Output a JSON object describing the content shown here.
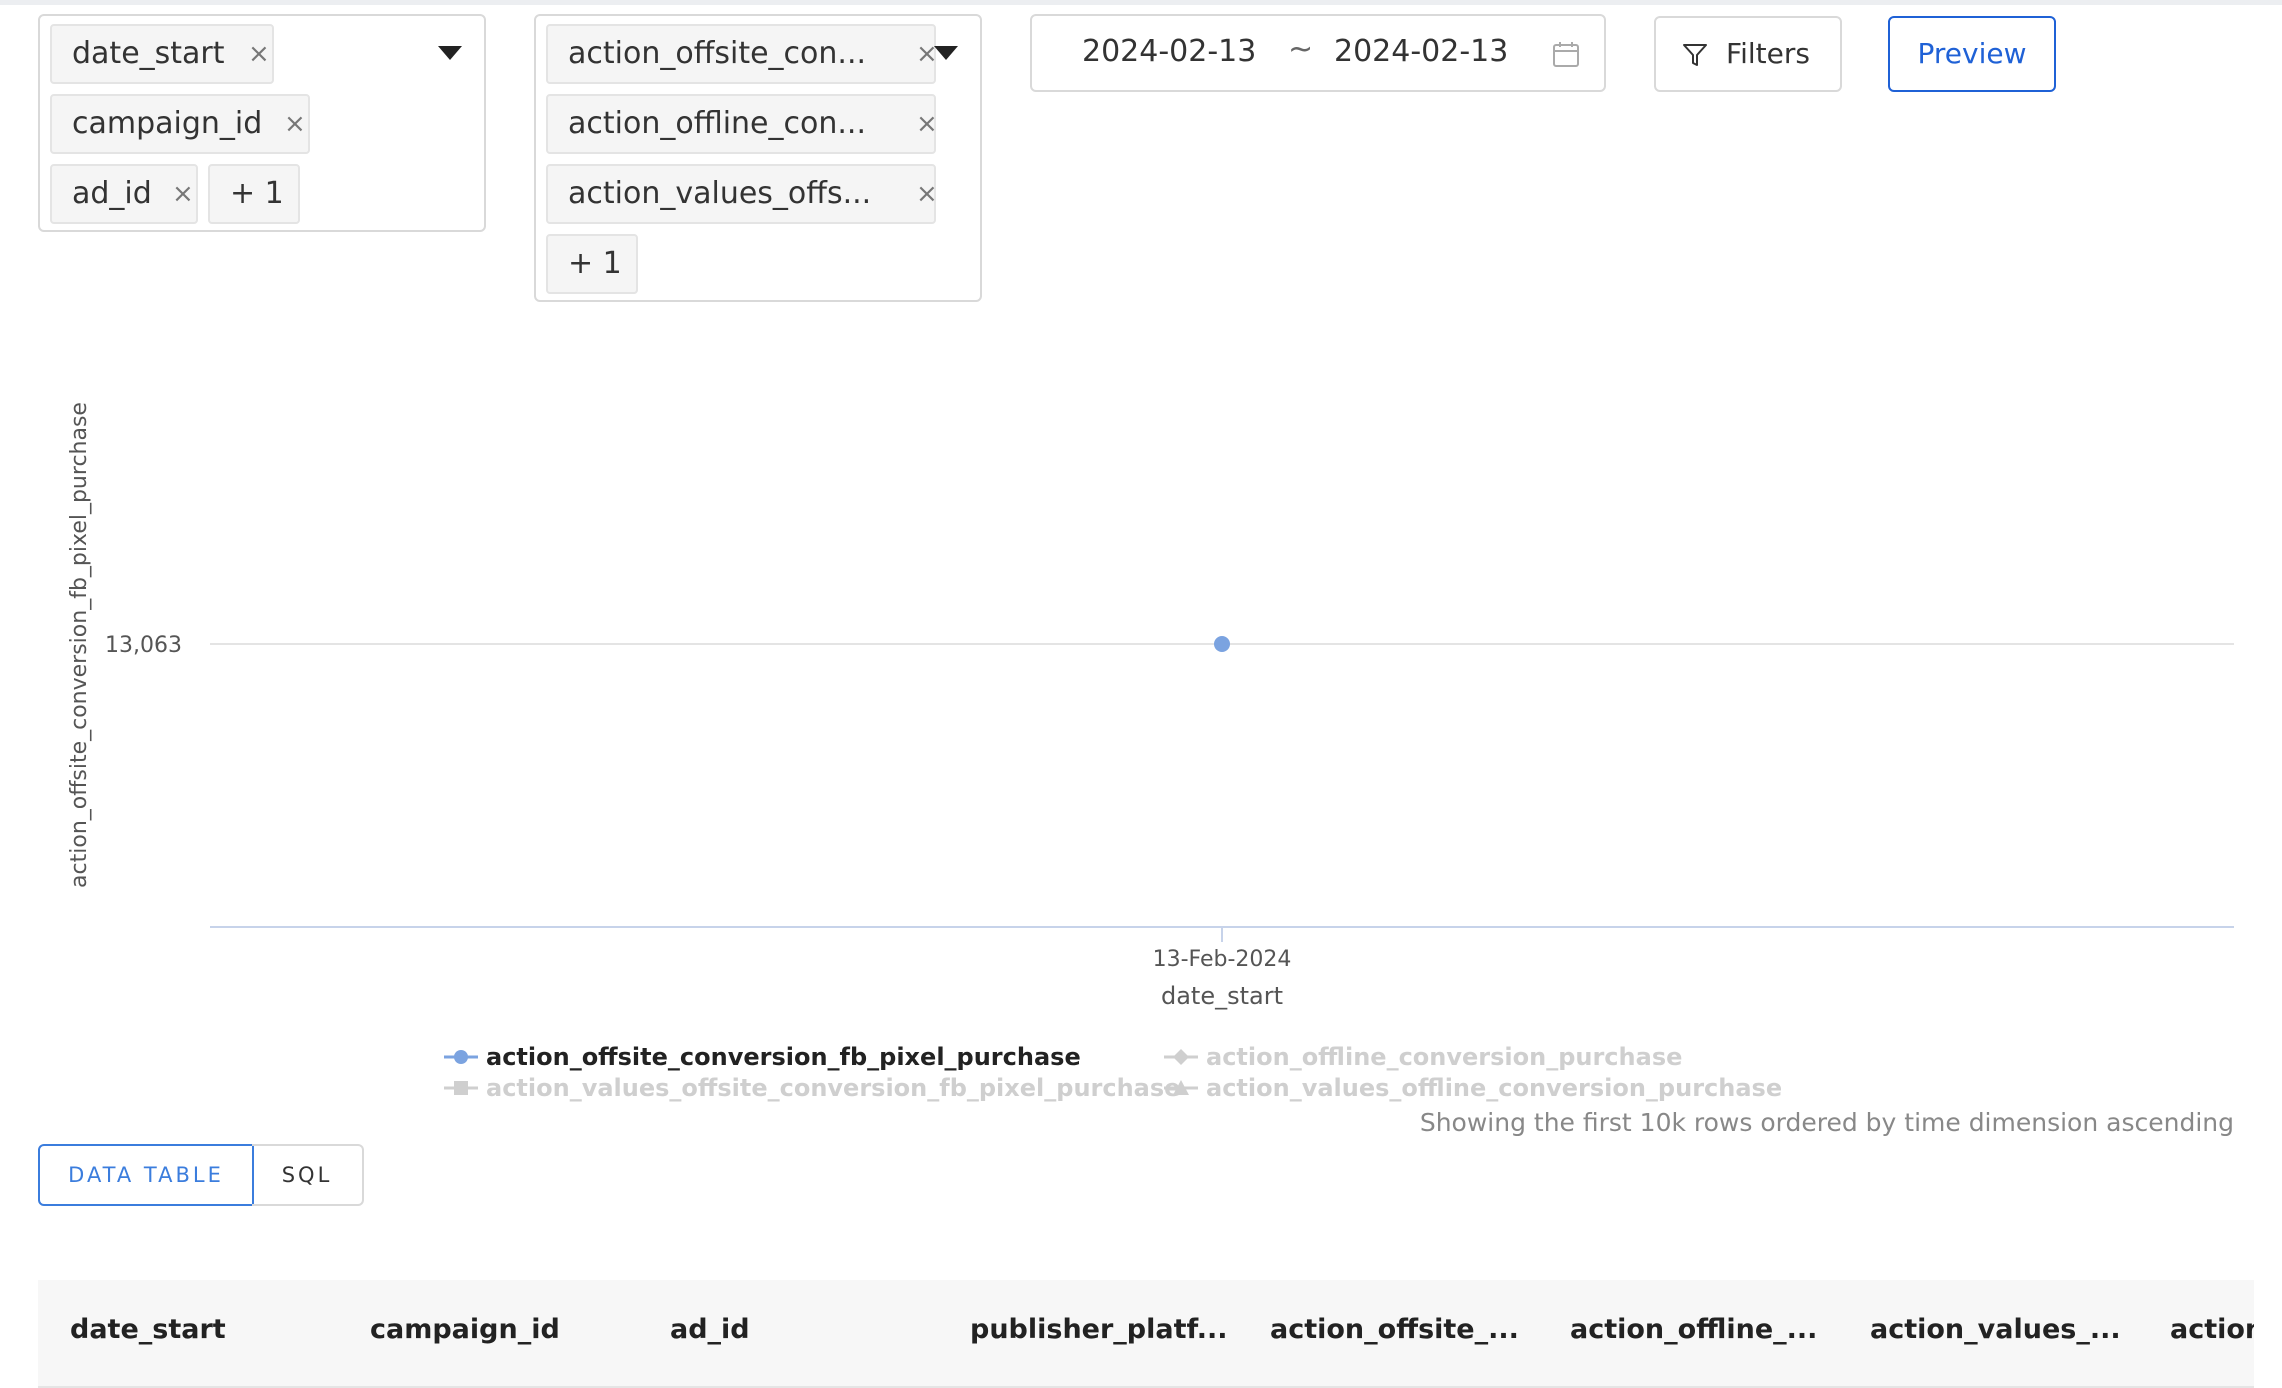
{
  "dimensions": {
    "tags": [
      "date_start",
      "campaign_id",
      "ad_id"
    ],
    "more": "+ 1"
  },
  "measures": {
    "tags": [
      "action_offsite_con...",
      "action_offline_con...",
      "action_values_offs..."
    ],
    "more": "+ 1"
  },
  "date_range": {
    "start": "2024-02-13",
    "separator": "~",
    "end": "2024-02-13"
  },
  "toolbar": {
    "filters_label": "Filters",
    "preview_label": "Preview"
  },
  "chart_data": {
    "type": "line",
    "x": [
      "13-Feb-2024"
    ],
    "series": [
      {
        "name": "action_offsite_conversion_fb_pixel_purchase",
        "values": [
          13063
        ]
      }
    ],
    "xlabel": "date_start",
    "ylabel": "action_offsite_conversion_fb_pixel_purchase",
    "y_tick_labels": [
      "13,063"
    ],
    "grid": true,
    "legend_position": "bottom"
  },
  "legend": [
    {
      "label": "action_offsite_conversion_fb_pixel_purchase",
      "marker": "circle",
      "active": true,
      "color": "#7ba3e0"
    },
    {
      "label": "action_offline_conversion_purchase",
      "marker": "diamond",
      "active": false,
      "color": "#cfcfcf"
    },
    {
      "label": "action_values_offsite_conversion_fb_pixel_purchase",
      "marker": "square",
      "active": false,
      "color": "#cfcfcf"
    },
    {
      "label": "action_values_offline_conversion_purchase",
      "marker": "triangle",
      "active": false,
      "color": "#cfcfcf"
    }
  ],
  "notice": "Showing the first 10k rows ordered by time dimension ascending",
  "tabs": {
    "data_table": "DATA TABLE",
    "sql": "SQL"
  },
  "table": {
    "columns": [
      "date_start",
      "campaign_id",
      "ad_id",
      "publisher_platf...",
      "action_offsite_...",
      "action_offline_...",
      "action_values_...",
      "action"
    ]
  },
  "colors": {
    "accent": "#1f61d6",
    "series": "#7ba3e0",
    "inactive": "#cfcfcf"
  },
  "icons": {
    "remove": "close-icon",
    "dropdown": "caret-down-icon",
    "calendar": "calendar-icon",
    "filter": "filter-icon"
  }
}
